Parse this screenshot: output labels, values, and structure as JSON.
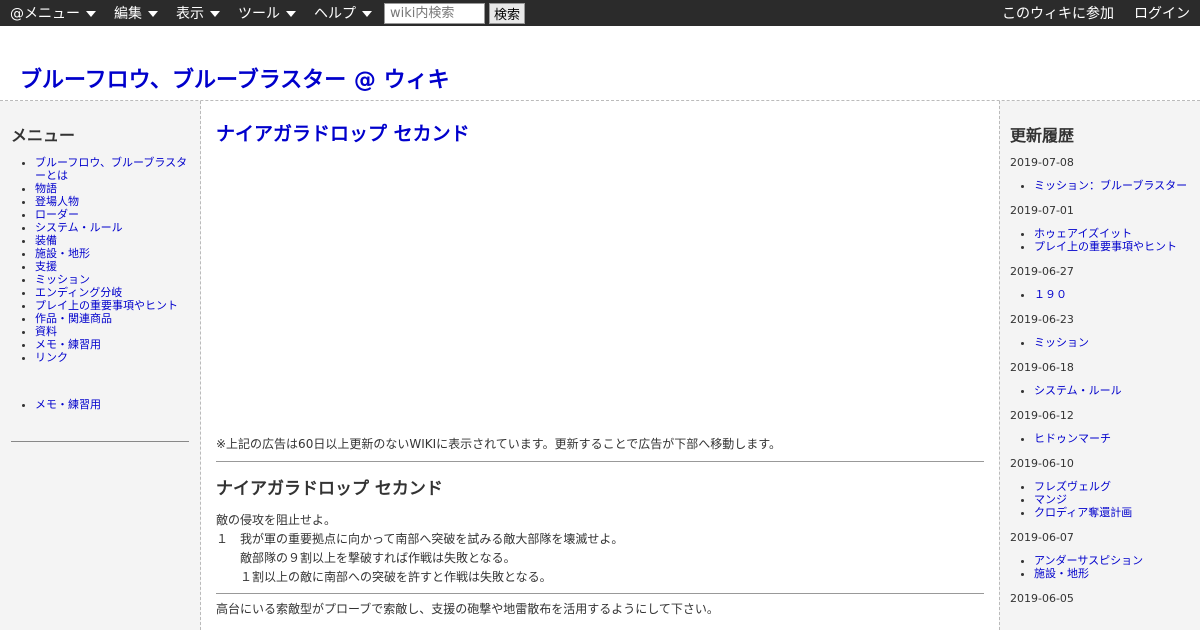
{
  "topbar": {
    "menus": [
      "@メニュー",
      "編集",
      "表示",
      "ツール",
      "ヘルプ"
    ],
    "search_placeholder": "wiki内検索",
    "search_button": "検索",
    "join_link": "このウィキに参加",
    "login_link": "ログイン"
  },
  "site": {
    "title": "ブルーフロウ、ブルーブラスター @ ウィキ"
  },
  "left": {
    "heading": "メニュー",
    "items": [
      "ブルーフロウ、ブルーブラスターとは",
      "物語",
      "登場人物",
      "ローダー",
      "システム・ルール",
      "装備",
      "施設・地形",
      "支援",
      "ミッション",
      "エンディング分岐",
      "プレイ上の重要事項やヒント",
      "作品・関連商品",
      "資料",
      "メモ・練習用",
      "リンク"
    ],
    "items2": [
      "メモ・練習用"
    ]
  },
  "main": {
    "page_title": "ナイアガラドロップ セカンド",
    "ad_note": "※上記の広告は60日以上更新のないWIKIに表示されています。更新することで広告が下部へ移動します。",
    "section_heading": "ナイアガラドロップ セカンド",
    "intro": "敵の侵攻を阻止せよ。",
    "objective_num": "１",
    "objective_text": "我が軍の重要拠点に向かって南部へ突破を試みる敵大部隊を壊滅せよ。",
    "cond1": "敵部隊の９割以上を撃破すれば作戦は失敗となる。",
    "cond2": "１割以上の敵に南部への突破を許すと作戦は失敗となる。",
    "tip": "高台にいる索敵型がプローブで索敵し、支援の砲撃や地雷散布を活用するようにして下さい。"
  },
  "right": {
    "heading": "更新履歴",
    "groups": [
      {
        "date": "2019-07-08",
        "items": [
          "ミッション：ブルーブラスター"
        ]
      },
      {
        "date": "2019-07-01",
        "items": [
          "ホゥェアイズイット",
          "プレイ上の重要事項やヒント"
        ]
      },
      {
        "date": "2019-06-27",
        "items": [
          "１９０"
        ]
      },
      {
        "date": "2019-06-23",
        "items": [
          "ミッション"
        ]
      },
      {
        "date": "2019-06-18",
        "items": [
          "システム・ルール"
        ]
      },
      {
        "date": "2019-06-12",
        "items": [
          "ヒドゥンマーチ"
        ]
      },
      {
        "date": "2019-06-10",
        "items": [
          "フレズヴェルグ",
          "マンジ",
          "クロディア奪還計画"
        ]
      },
      {
        "date": "2019-06-07",
        "items": [
          "アンダーサスピション",
          "施設・地形"
        ]
      },
      {
        "date": "2019-06-05",
        "items": []
      }
    ]
  }
}
